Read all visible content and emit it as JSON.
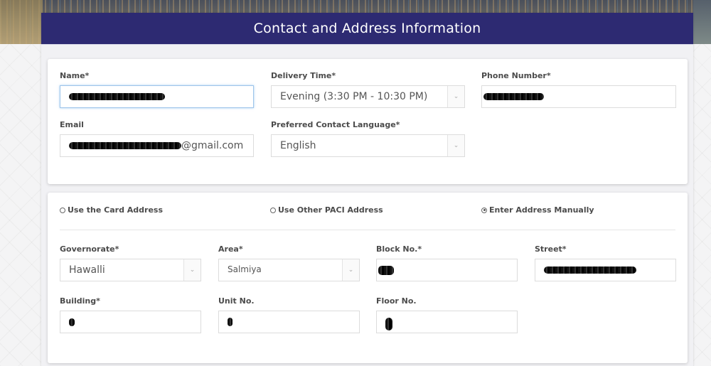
{
  "header": {
    "title": "Contact and Address Information"
  },
  "contact": {
    "name": {
      "label": "Name*",
      "value": "[redacted]"
    },
    "delivery_time": {
      "label": "Delivery Time*",
      "value": "Evening (3:30 PM - 10:30 PM)"
    },
    "phone": {
      "label": "Phone Number*",
      "value": "[redacted]"
    },
    "email": {
      "label": "Email",
      "value_suffix": "@gmail.com"
    },
    "language": {
      "label": "Preferred Contact Language*",
      "value": "English"
    }
  },
  "address": {
    "options": [
      {
        "label": "Use the Card Address",
        "selected": false
      },
      {
        "label": "Use Other PACI Address",
        "selected": false
      },
      {
        "label": "Enter Address Manually",
        "selected": true
      }
    ],
    "governorate": {
      "label": "Governorate*",
      "value": "Hawalli"
    },
    "area": {
      "label": "Area*",
      "value": "Salmiya"
    },
    "block": {
      "label": "Block No.*",
      "value": "[redacted]"
    },
    "street": {
      "label": "Street*",
      "value": "[redacted]"
    },
    "building": {
      "label": "Building*",
      "value": "[redacted]"
    },
    "unit": {
      "label": "Unit No.",
      "value": "[redacted]"
    },
    "floor": {
      "label": "Floor No.",
      "value": "[redacted]"
    }
  },
  "icons": {
    "caret": "⌄"
  },
  "colors": {
    "header_bg": "#2d2a72",
    "focus_border": "#9ec4ea"
  }
}
